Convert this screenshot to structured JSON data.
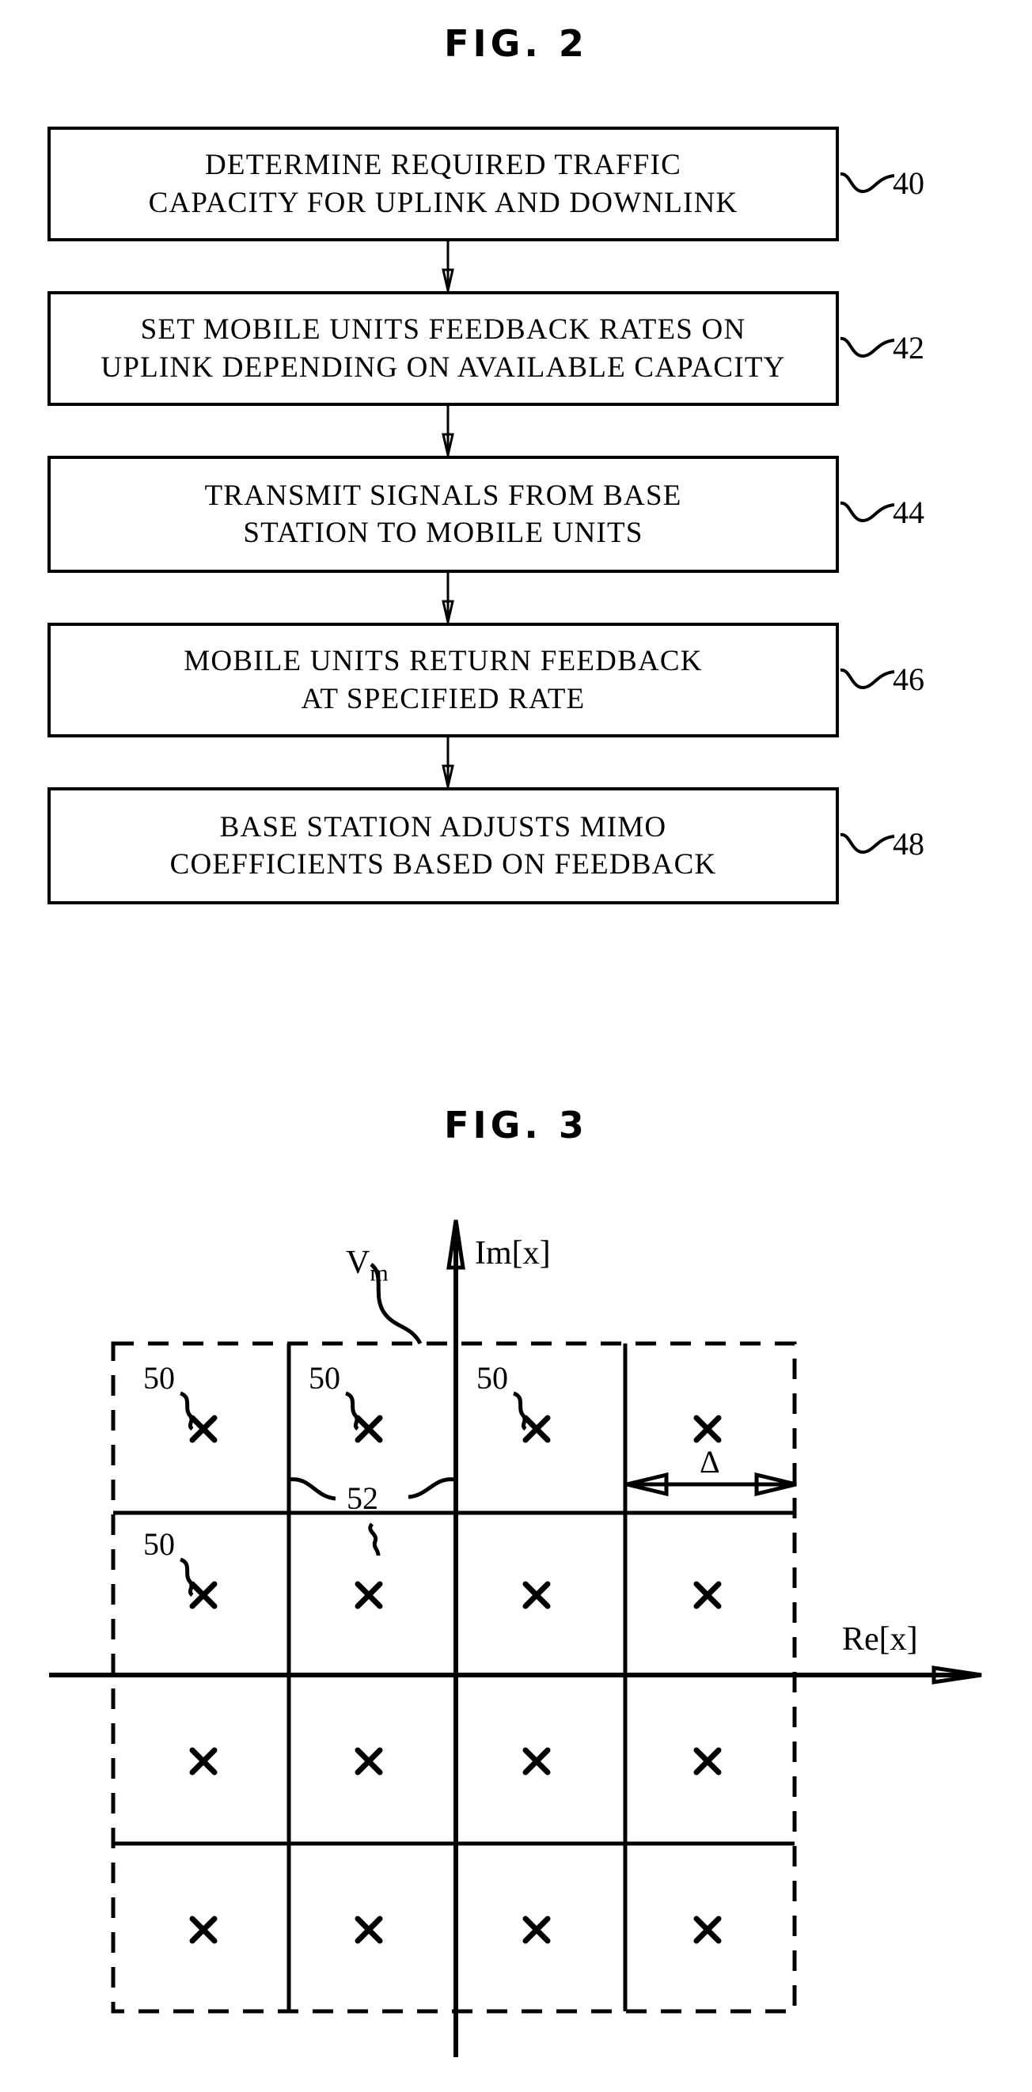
{
  "figures": [
    {
      "id": "fig2",
      "title": "FIG.  2",
      "type": "flowchart",
      "steps": [
        {
          "ref": "40",
          "lines": [
            "DETERMINE  REQUIRED  TRAFFIC",
            "CAPACITY  FOR  UPLINK  AND  DOWNLINK"
          ]
        },
        {
          "ref": "42",
          "lines": [
            "SET  MOBILE  UNITS  FEEDBACK  RATES  ON",
            "UPLINK  DEPENDING  ON  AVAILABLE  CAPACITY"
          ]
        },
        {
          "ref": "44",
          "lines": [
            "TRANSMIT  SIGNALS  FROM  BASE",
            "STATION  TO  MOBILE  UNITS"
          ]
        },
        {
          "ref": "46",
          "lines": [
            "MOBILE  UNITS  RETURN  FEEDBACK",
            "AT  SPECIFIED  RATE"
          ]
        },
        {
          "ref": "48",
          "lines": [
            "BASE  STATION  ADJUSTS  MIMO",
            "COEFFICIENTS  BASED  ON  FEEDBACK"
          ]
        }
      ]
    },
    {
      "id": "fig3",
      "title": "FIG.  3",
      "type": "constellation-diagram",
      "axes": {
        "vertical_label": "Im[x]",
        "horizontal_label": "Re[x]"
      },
      "annotations": {
        "quantization_region_label": "V",
        "quantization_region_subscript": "m",
        "constellation_point_refs": [
          "50",
          "50",
          "50",
          "50"
        ],
        "decision_boundary_ref": "52",
        "spacing_label": "Δ"
      },
      "grid": {
        "rows": 4,
        "cols": 4,
        "point_marker": "×",
        "outer_border_style": "dashed",
        "inner_border_style": "solid"
      }
    }
  ]
}
